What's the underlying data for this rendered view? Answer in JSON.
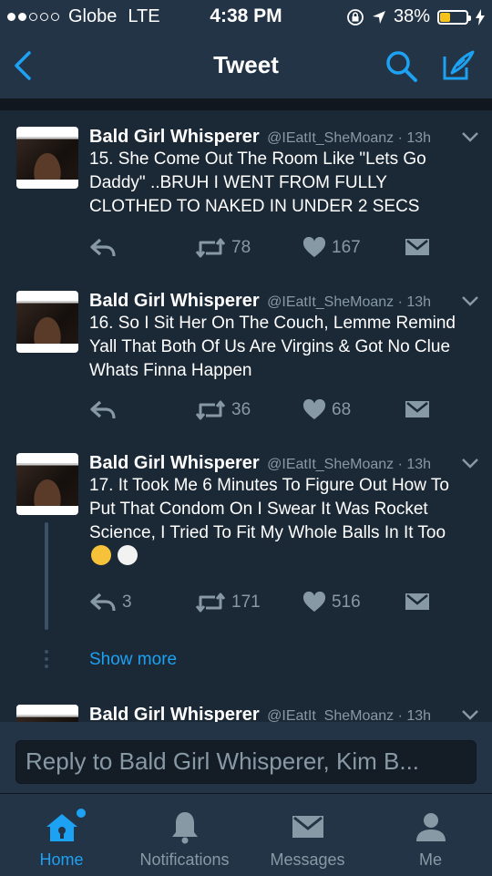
{
  "status_bar": {
    "carrier": "Globe",
    "network": "LTE",
    "time": "4:38 PM",
    "battery": "38%",
    "battery_level": 0.38,
    "signal_bars_filled": 2,
    "signal_bars_total": 5
  },
  "nav": {
    "title": "Tweet",
    "back_icon": "chevron-left-icon",
    "search_icon": "search-icon",
    "compose_icon": "compose-icon"
  },
  "tweets": [
    {
      "name": "Bald Girl Whisperer",
      "handle": "@IEatIt_SheMoanz",
      "time": "· 13h",
      "text": "15. She Come Out The Room Like \"Lets Go Daddy\" ..BRUH I WENT FROM FULLY CLOTHED TO NAKED IN UNDER 2 SECS",
      "replies": "",
      "retweets": "78",
      "likes": "167"
    },
    {
      "name": "Bald Girl Whisperer",
      "handle": "@IEatIt_SheMoanz",
      "time": "· 13h",
      "text": "16. So I Sit Her On The Couch, Lemme Remind Yall That Both Of Us Are Virgins & Got No Clue Whats Finna Happen",
      "replies": "",
      "retweets": "36",
      "likes": "68"
    },
    {
      "name": "Bald Girl Whisperer",
      "handle": "@IEatIt_SheMoanz",
      "time": "· 13h",
      "text": "17. It Took Me 6 Minutes To Figure Out How To Put That Condom On I Swear It Was Rocket Science, I Tried To Fit My Whole Balls In It Too",
      "emojis": [
        "crying-face-emoji",
        "skull-emoji"
      ],
      "replies": "3",
      "retweets": "171",
      "likes": "516"
    },
    {
      "name": "Bald Girl Whisperer",
      "handle": "@IEatIt_SheMoanz",
      "time": "· 13h"
    }
  ],
  "show_more": "Show more",
  "reply": {
    "placeholder": "Reply to Bald Girl Whisperer, Kim B..."
  },
  "tabs": [
    {
      "label": "Home",
      "icon": "home-icon",
      "active": true
    },
    {
      "label": "Notifications",
      "icon": "bell-icon",
      "active": false
    },
    {
      "label": "Messages",
      "icon": "envelope-icon",
      "active": false
    },
    {
      "label": "Me",
      "icon": "person-icon",
      "active": false
    }
  ],
  "colors": {
    "accent": "#1da1f2",
    "background": "#141d26",
    "card": "#1b2836",
    "bar": "#243447",
    "muted": "#8899a6"
  }
}
